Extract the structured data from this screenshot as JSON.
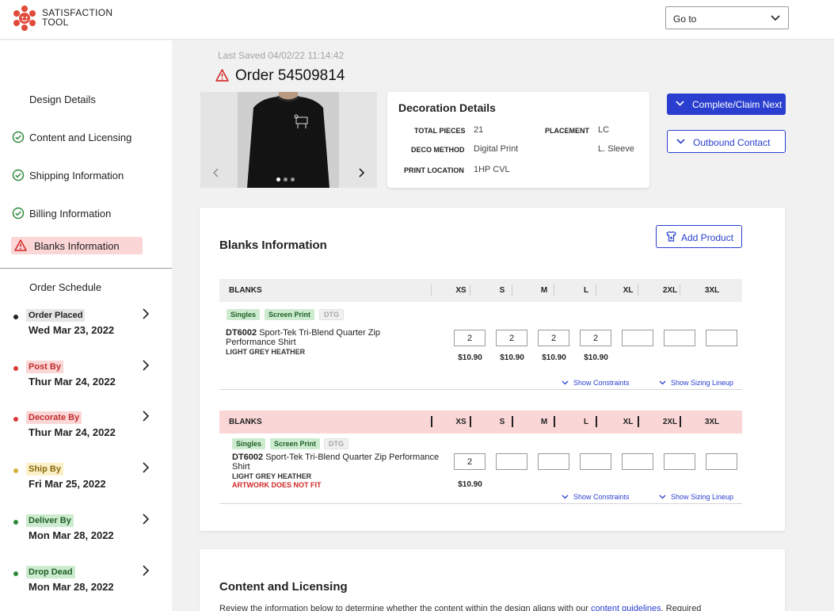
{
  "app": {
    "logo_line1": "SATISFACTION",
    "logo_line2": "TOOL"
  },
  "header": {
    "goto_label": "Go to"
  },
  "sidebar": {
    "items": [
      {
        "label": "Design Details",
        "state": "none"
      },
      {
        "label": "Content and Licensing",
        "state": "done"
      },
      {
        "label": "Shipping Information",
        "state": "done"
      },
      {
        "label": "Billing Information",
        "state": "done"
      },
      {
        "label": "Blanks Information",
        "state": "error"
      }
    ],
    "schedule_title": "Order Schedule",
    "schedule": [
      {
        "label": "Order Placed",
        "date": "Wed Mar 23, 2022",
        "color": "#222222",
        "badge_bg": "#e6e6e6",
        "badge_fg": "#222222"
      },
      {
        "label": "Post By",
        "date": "Thur Mar 24, 2022",
        "color": "#d83a3a",
        "badge_bg": "#fbd6d6",
        "badge_fg": "#c22d2d"
      },
      {
        "label": "Decorate By",
        "date": "Thur Mar 24, 2022",
        "color": "#d83a3a",
        "badge_bg": "#fbd6d6",
        "badge_fg": "#c22d2d"
      },
      {
        "label": "Ship By",
        "date": "Fri Mar 25, 2022",
        "color": "#d6b23a",
        "badge_bg": "#fbf0c7",
        "badge_fg": "#8a6a10"
      },
      {
        "label": "Deliver By",
        "date": "Mon Mar 28, 2022",
        "color": "#2f8a3c",
        "badge_bg": "#cdeccf",
        "badge_fg": "#1f5f27"
      },
      {
        "label": "Drop Dead",
        "date": "Mon Mar 28, 2022",
        "color": "#2f8a3c",
        "badge_bg": "#cdeccf",
        "badge_fg": "#1f5f27"
      }
    ]
  },
  "order": {
    "last_saved": "Last Saved 04/02/22  11:14:42",
    "title": "Order 54509814"
  },
  "decoration": {
    "title": "Decoration Details",
    "total_pieces_label": "TOTAL PIECES",
    "total_pieces": "21",
    "placement_label": "PLACEMENT",
    "placement_1": "LC",
    "placement_2": "L. Sleeve",
    "deco_method_label": "DECO METHOD",
    "deco_method": "Digital Print",
    "print_location_label": "PRINT LOCATION",
    "print_location": "1HP CVL"
  },
  "actions": {
    "complete_label": "Complete/Claim Next",
    "outbound_label": "Outbound Contact"
  },
  "blanks": {
    "title": "Blanks Information",
    "add_product_label": "Add Product",
    "header_label": "BLANKS",
    "sizes": [
      "XS",
      "S",
      "M",
      "L",
      "XL",
      "2XL",
      "3XL"
    ],
    "rows": [
      {
        "tags": [
          "Singles",
          "Screen Print",
          "DTG"
        ],
        "sku": "DT6002",
        "name_line1": "Sport-Tek Tri-Blend Quarter Zip",
        "name_line2": "Performance Shirt",
        "color": "LIGHT GREY HEATHER",
        "error": "",
        "qty": [
          "2",
          "2",
          "2",
          "2",
          "",
          "",
          ""
        ],
        "prices": [
          "$10.90",
          "$10.90",
          "$10.90",
          "$10.90"
        ]
      },
      {
        "tags": [
          "Singles",
          "Screen Print",
          "DTG"
        ],
        "sku": "DT6002",
        "name_line1": "Sport-Tek Tri-Blend Quarter Zip Performance",
        "name_line2": "Shirt",
        "color": "LIGHT GREY HEATHER",
        "error": "ARTWORK DOES NOT FIT",
        "qty": [
          "2",
          "",
          "",
          "",
          "",
          "",
          ""
        ],
        "prices": [
          "$10.90"
        ]
      }
    ],
    "show_constraints": "Show Constraints",
    "show_sizing": "Show Sizing Lineup"
  },
  "content": {
    "title": "Content and Licensing",
    "desc_prefix": "Review the information below to determine whether the content within the design aligns with our ",
    "desc_link": "content guidelines",
    "desc_suffix": ". Required"
  },
  "colors": {
    "accent": "#2a3fcf",
    "error_bg": "#fbd6d6",
    "success": "#2f8a3c",
    "error": "#d22727"
  }
}
